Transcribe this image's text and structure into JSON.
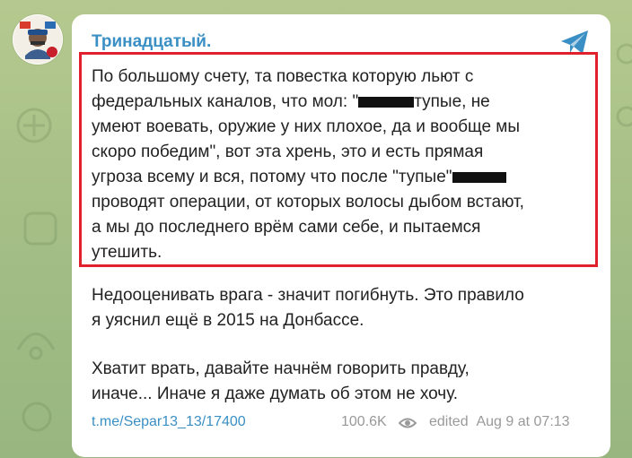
{
  "channel": {
    "name": "Тринадцатый."
  },
  "message": {
    "quoted": {
      "part1": "По большому счету, та повестка которую льют с\nфедеральных каналов, что мол: \"",
      "part2": "тупые, не\nумеют воевать, оружие у них плохое, да и вообще мы\nскоро победим\", вот эта хрень, это и есть прямая\nугроза всему и вся, потому что после \"тупые\"",
      "part3": "\nпроводят операции, от которых волосы дыбом встают,\nа мы до последнего врём сами себе, и пытаемся\nутешить."
    },
    "paragraph2": "Недооценивать врага - значит погибнуть. Это правило\nя уяснил ещё в 2015 на Донбассе.",
    "paragraph3": "Хватит врать, давайте начнём говорить правду,\nиначе... Иначе я даже думать об этом не хочу."
  },
  "footer": {
    "link": "t.me/Separ13_13/17400",
    "views": "100.6K",
    "edited": "edited",
    "date": "Aug 9 at 07:13"
  },
  "colors": {
    "link": "#3a8fc4",
    "highlight_box": "#e0202c",
    "meta": "#999999"
  },
  "icons": [
    "share-icon",
    "eye-icon",
    "avatar-image"
  ]
}
